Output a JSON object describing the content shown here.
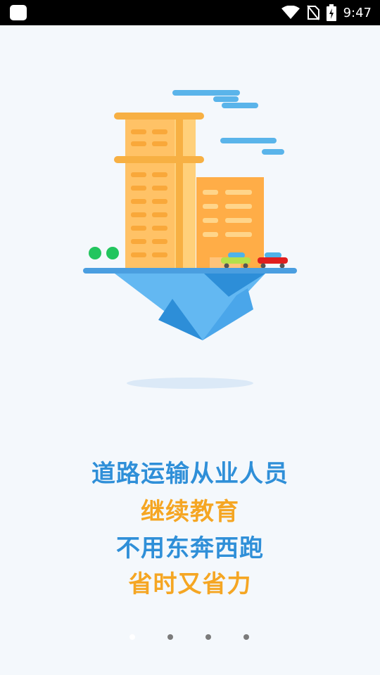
{
  "status_bar": {
    "time": "9:47"
  },
  "slogan": {
    "line1": "道路运输从业人员",
    "line2": "继续教育",
    "line3": "不用东奔西跑",
    "line4": "省时又省力",
    "colors": {
      "blue": "#2f8fd8",
      "orange": "#f5a623"
    }
  },
  "pager": {
    "count": 4,
    "active_index": 0
  },
  "icons": {
    "wifi": "wifi-icon",
    "no_sim": "no-sim-icon",
    "battery": "battery-charging-icon",
    "app": "app-notification-icon"
  }
}
